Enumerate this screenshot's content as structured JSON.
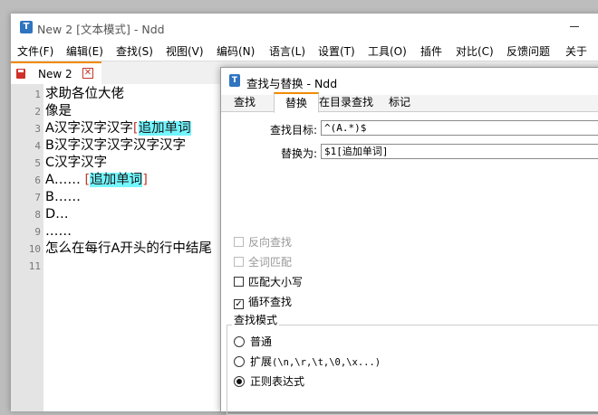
{
  "window": {
    "title": "New 2 [文本模式] - Ndd",
    "app_icon": "T"
  },
  "menu": [
    "文件(F)",
    "编辑(E)",
    "查找(S)",
    "视图(V)",
    "编码(N)",
    "语言(L)",
    "设置(T)",
    "工具(O)",
    "插件",
    "对比(C)",
    "反馈问题",
    "关于"
  ],
  "tab": {
    "label": "New 2",
    "close_glyph": "✕"
  },
  "editor": {
    "line_numbers": [
      "1",
      "2",
      "3",
      "4",
      "5",
      "6",
      "7",
      "8",
      "9",
      "10",
      "11"
    ],
    "lines": [
      {
        "pre": "求助各位大佬",
        "hl": "",
        "post": ""
      },
      {
        "pre": "像是",
        "hl": "",
        "post": ""
      },
      {
        "pre": "A汉字汉字汉字",
        "hl": "追加单词",
        "post": ""
      },
      {
        "pre": "B汉字汉字汉字汉字汉字",
        "hl": "",
        "post": ""
      },
      {
        "pre": "C汉字汉字",
        "hl": "",
        "post": ""
      },
      {
        "pre": "A…… ",
        "hl": "追加单词",
        "post": ""
      },
      {
        "pre": "B……",
        "hl": "",
        "post": ""
      },
      {
        "pre": "D…",
        "hl": "",
        "post": ""
      },
      {
        "pre": "……",
        "hl": "",
        "post": ""
      },
      {
        "pre": "怎么在每行A开头的行中结尾",
        "hl": "",
        "post": ""
      },
      {
        "pre": "",
        "hl": "",
        "post": ""
      }
    ],
    "line3_open": "[",
    "line3_close": "",
    "line6_open": "[",
    "line6_close": "]"
  },
  "dialog": {
    "title": "查找与替换 - Ndd",
    "app_icon": "T",
    "tabs": [
      "查找",
      "替换",
      "在目录查找",
      "标记"
    ],
    "active_tab": "替换",
    "find_label": "查找目标:",
    "find_value": "^(A.*)$",
    "replace_label": "替换为:",
    "replace_value": "$1[追加单词]",
    "options": [
      {
        "label": "反向查找",
        "checked": false,
        "disabled": true
      },
      {
        "label": "全词匹配",
        "checked": false,
        "disabled": true
      },
      {
        "label": "匹配大小写",
        "checked": false,
        "disabled": false
      },
      {
        "label": "循环查找",
        "checked": true,
        "disabled": false
      }
    ],
    "mode_title": "查找模式",
    "modes": [
      {
        "label": "普通",
        "extra": "",
        "selected": false
      },
      {
        "label": "扩展",
        "extra": "(\\n,\\r,\\t,\\0,\\x...)",
        "selected": false
      },
      {
        "label": "正则表达式",
        "extra": "",
        "selected": true
      }
    ]
  },
  "colors": {
    "accent": "#f28a00",
    "highlight": "#73f6ff",
    "bracket": "#c0392b",
    "gutter": "#e4e4e4"
  }
}
